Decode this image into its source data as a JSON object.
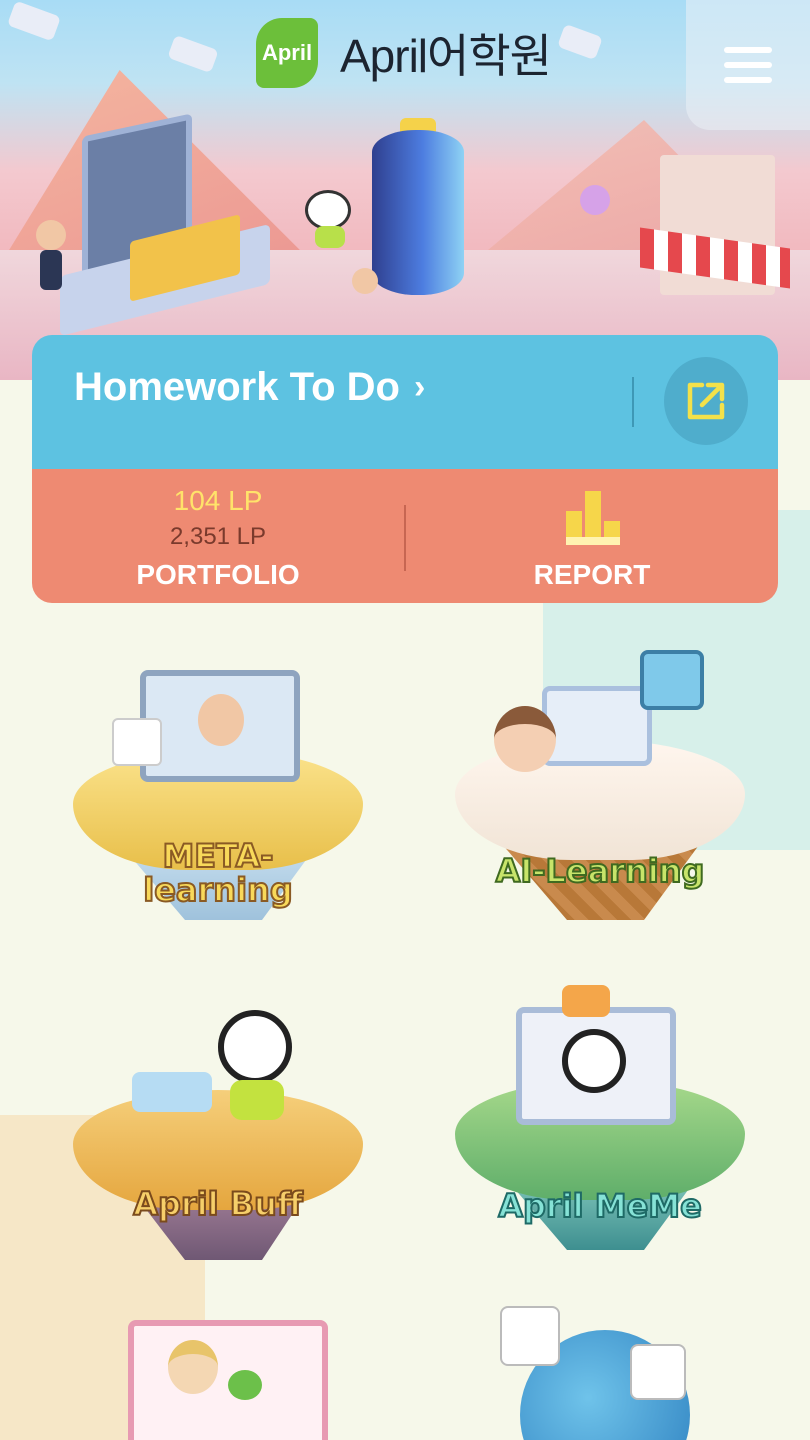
{
  "header": {
    "logo_badge": "April",
    "logo_text": "April어학원",
    "menu_icon": "hamburger-menu-icon"
  },
  "homework": {
    "title": "Homework To Do",
    "chevron": "›",
    "open_icon": "external-link-icon"
  },
  "portfolio": {
    "lp_current": "104 LP",
    "lp_total": "2,351 LP",
    "label": "PORTFOLIO"
  },
  "report": {
    "label": "REPORT",
    "icon": "bar-chart-icon"
  },
  "tiles": [
    {
      "label": "META-learning",
      "label_line1": "META-",
      "label_line2": "learning"
    },
    {
      "label": "AI-Learning"
    },
    {
      "label": "April Buff"
    },
    {
      "label": "April MeMe"
    }
  ],
  "colors": {
    "homework_bg": "#5dc2e1",
    "portfolio_bg": "#ee8a72",
    "lp_highlight": "#ffe36a",
    "logo_green": "#6cbf3a",
    "page_bg": "#f6f8ea"
  }
}
